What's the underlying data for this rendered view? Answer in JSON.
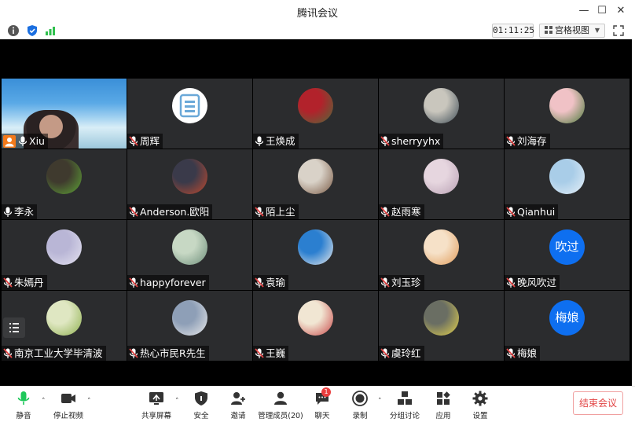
{
  "window": {
    "title": "腾讯会议"
  },
  "infobar": {
    "timer": "01:11:25",
    "view_label": "宫格视图"
  },
  "participants": [
    {
      "name": "Xiu",
      "kind": "self",
      "mic": "on",
      "host": true
    },
    {
      "name": "周辉",
      "kind": "logo",
      "mic": "off",
      "colors": [
        "#ffffff",
        "#6aa8d8"
      ]
    },
    {
      "name": "王焕成",
      "kind": "photo",
      "mic": "on",
      "colors": [
        "#b2222b",
        "#4f6b3a"
      ]
    },
    {
      "name": "sherryyhx",
      "kind": "photo",
      "mic": "off",
      "colors": [
        "#c9c6bd",
        "#3e4c56"
      ]
    },
    {
      "name": "刘海存",
      "kind": "photo",
      "mic": "off",
      "colors": [
        "#f0c2c6",
        "#4b7a3a"
      ]
    },
    {
      "name": "李永",
      "kind": "photo",
      "mic": "on",
      "colors": [
        "#3f3a2e",
        "#5ea536"
      ]
    },
    {
      "name": "Anderson.欧阳",
      "kind": "photo",
      "mic": "off",
      "colors": [
        "#3a3a4a",
        "#c24a2e"
      ]
    },
    {
      "name": "陌上尘",
      "kind": "photo",
      "mic": "off",
      "colors": [
        "#d9d2c8",
        "#7a5a44"
      ]
    },
    {
      "name": "赵雨寒",
      "kind": "photo",
      "mic": "off",
      "colors": [
        "#e6d6df",
        "#b8a0b3"
      ]
    },
    {
      "name": "Qianhui",
      "kind": "photo",
      "mic": "off",
      "colors": [
        "#a9cde8",
        "#e7f0f7"
      ]
    },
    {
      "name": "朱嫣丹",
      "kind": "photo",
      "mic": "off",
      "colors": [
        "#b9b6d6",
        "#e4e2ef"
      ]
    },
    {
      "name": "happyforever",
      "kind": "photo",
      "mic": "off",
      "colors": [
        "#c7d8c4",
        "#6d8e7a"
      ]
    },
    {
      "name": "袁瑜",
      "kind": "photo",
      "mic": "off",
      "colors": [
        "#2b7fd0",
        "#e9e9e9"
      ]
    },
    {
      "name": "刘玉珍",
      "kind": "photo",
      "mic": "off",
      "colors": [
        "#f6e1c8",
        "#e09b59"
      ]
    },
    {
      "name": "晚风吹过",
      "kind": "text",
      "mic": "off",
      "avatar_text": "吹过"
    },
    {
      "name": "南京工业大学毕清波",
      "kind": "photo",
      "mic": "off",
      "colors": [
        "#dfe7c2",
        "#8fb04f"
      ]
    },
    {
      "name": "热心市民R先生",
      "kind": "photo",
      "mic": "off",
      "colors": [
        "#8e9fb7",
        "#eaeaea"
      ]
    },
    {
      "name": "王巍",
      "kind": "photo",
      "mic": "off",
      "colors": [
        "#f1e6d3",
        "#c84848"
      ]
    },
    {
      "name": "虞玲红",
      "kind": "photo",
      "mic": "off",
      "colors": [
        "#6a6e63",
        "#e6d44c"
      ]
    },
    {
      "name": "梅娘",
      "kind": "text",
      "mic": "off",
      "avatar_text": "梅娘"
    }
  ],
  "toolbar": {
    "mute": "静音",
    "stop_video": "停止视频",
    "share_screen": "共享屏幕",
    "security": "安全",
    "invite": "邀请",
    "manage_members": "管理成员(20)",
    "chat": "聊天",
    "chat_badge": "1",
    "record": "录制",
    "breakout": "分组讨论",
    "apps": "应用",
    "settings": "设置",
    "end_meeting": "结束会议"
  },
  "colors": {
    "mic_on": "#1ec85a",
    "mic_off": "#e04545",
    "end": "#e24444",
    "avatar_blue": "#0e6ff0"
  }
}
